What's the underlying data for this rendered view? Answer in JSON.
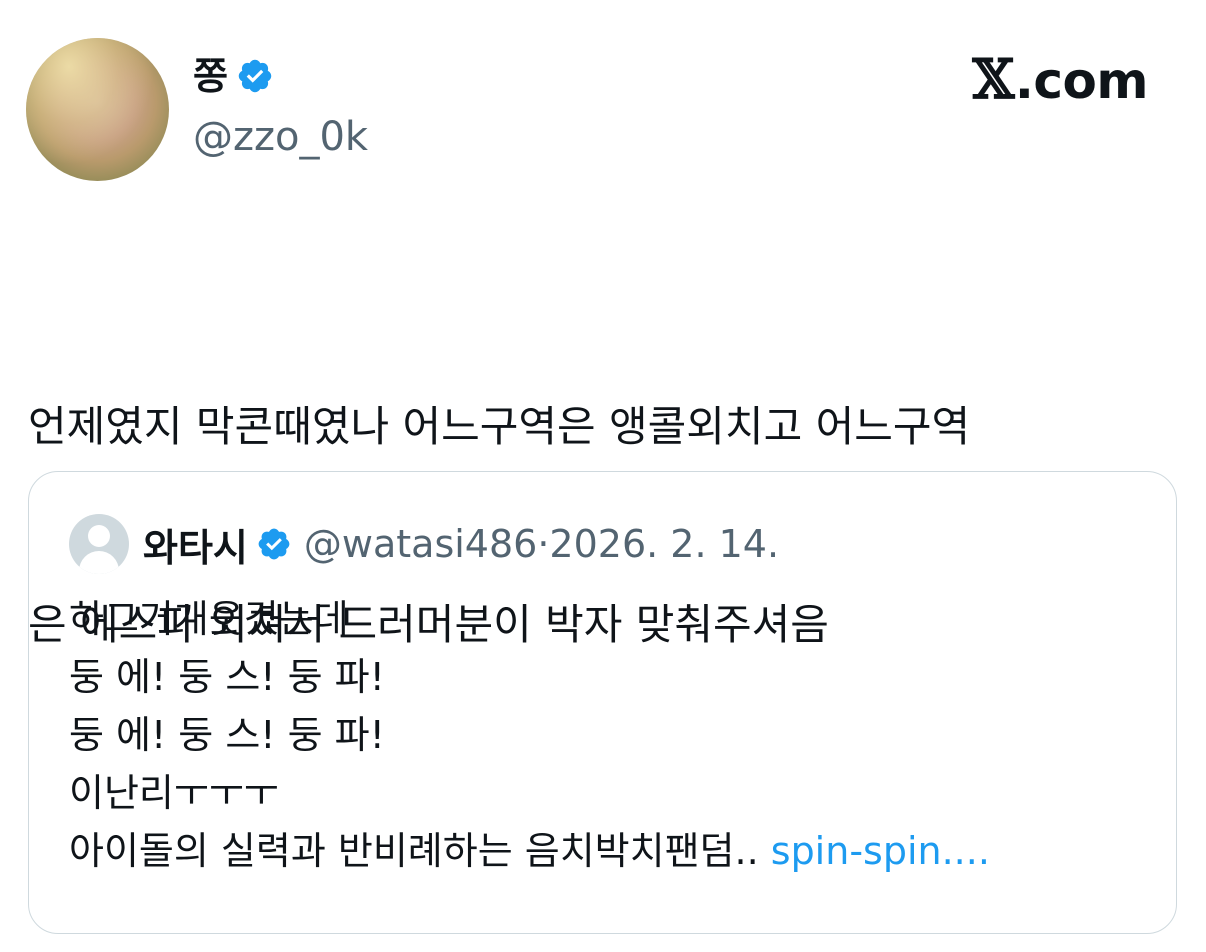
{
  "author": {
    "display_name": "쫑",
    "handle": "@zzo_0k",
    "avatar": "profile-photo",
    "verified_icon": "verified-badge-icon",
    "verified_color": "#1d9bf0"
  },
  "brand": {
    "x": "𝕏",
    "domain": ".com"
  },
  "tweet": {
    "line1": "언제였지 막콘때였나 어느구역은 앵콜외치고 어느구역",
    "line2": "은 에스파 외쳐서 드러머분이 박자 맞춰주셔음"
  },
  "quote": {
    "display_name": "와타시",
    "handle": "@watasi486",
    "separator": "·",
    "date": "2026. 2. 14.",
    "lines": [
      "하그거개웃겼는데",
      "둥 에! 둥 스! 둥 파!",
      "둥 에! 둥 스! 둥 파!",
      "이난리ㅜㅜㅜ",
      "아이돌의 실력과 반비례하는 음치박치팬덤.. "
    ],
    "more_link": "spin-spin....",
    "link_color": "#1d9bf0"
  }
}
